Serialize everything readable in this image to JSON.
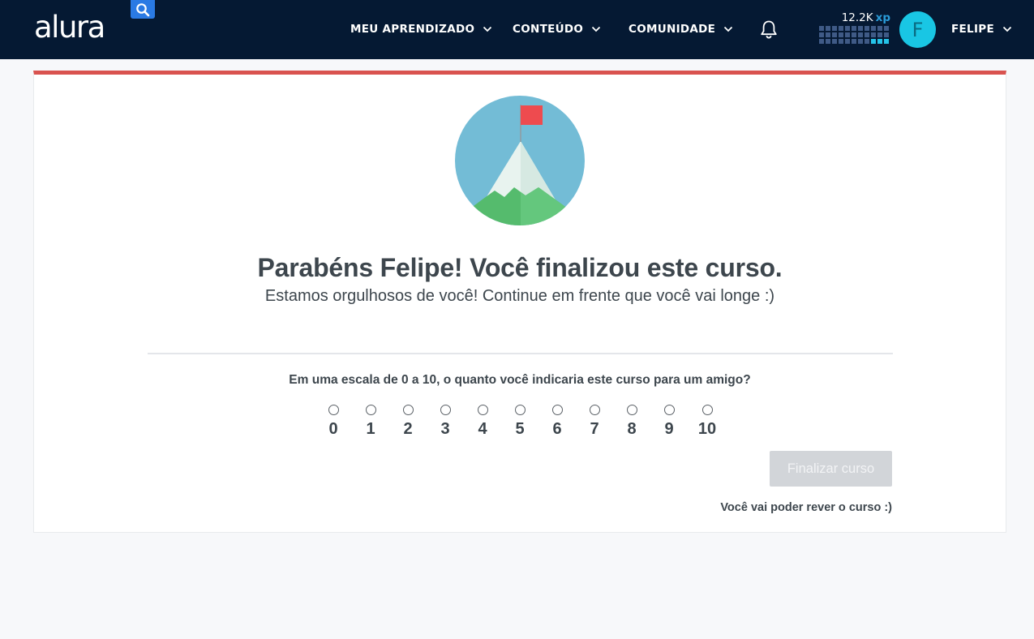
{
  "header": {
    "logo": "alura",
    "nav": [
      {
        "label": "MEU APRENDIZADO"
      },
      {
        "label": "CONTEÚDO"
      },
      {
        "label": "COMUNIDADE"
      }
    ],
    "xp": {
      "value": "12.2K",
      "unit": "xp"
    },
    "user": {
      "initial": "F",
      "name": "FELIPE"
    }
  },
  "main": {
    "title": "Parabéns Felipe! Você finalizou este curso.",
    "subtitle": "Estamos orgulhosos de você! Continue em frente que você vai longe :)",
    "question": "Em uma escala de 0 a 10, o quanto você indicaria este curso para um amigo?",
    "scale": [
      "0",
      "1",
      "2",
      "3",
      "4",
      "5",
      "6",
      "7",
      "8",
      "9",
      "10"
    ],
    "finish_button": "Finalizar curso",
    "note": "Você vai poder rever o curso :)"
  },
  "colors": {
    "header_bg": "#051933",
    "accent_top_border": "#d9534f",
    "search_button": "#2a7ae4",
    "avatar": "#19c6e4",
    "button_disabled": "#d2d5d9"
  },
  "icons": [
    "search-icon",
    "chevron-down-icon",
    "bell-icon",
    "mountain-flag-icon"
  ]
}
